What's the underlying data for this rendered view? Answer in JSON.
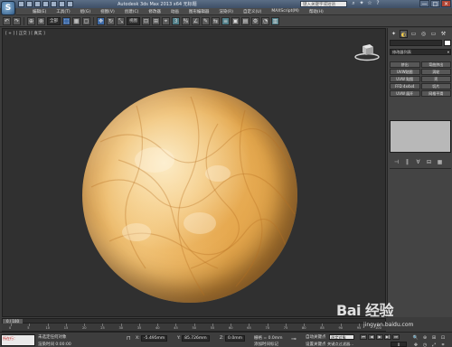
{
  "title_bar": {
    "logo_letter": "S",
    "title": "Autodesk 3ds Max 2013 x64    无标题",
    "search_placeholder": "键入关键字或短语",
    "minimize": "—",
    "maximize": "□",
    "close": "×"
  },
  "menu": [
    "编辑(E)",
    "工具(T)",
    "组(G)",
    "视图(V)",
    "创建(C)",
    "修改器",
    "动画",
    "图形编辑器",
    "渲染(R)",
    "自定义(U)",
    "MAXScript(M)",
    "帮助(H)"
  ],
  "toolbar": {
    "selection_filter": "全部",
    "reference_coord": "视图",
    "buttons": [
      "↶",
      "↷",
      "⊕",
      "⊗",
      "⬚",
      "▦",
      "▢",
      "✥",
      "↻",
      "⤡",
      "⊡",
      "⊞",
      "⌖",
      "3",
      "%",
      "∠",
      "✎",
      "⇆",
      "≡",
      "▣",
      "▤",
      "⚙",
      "◔",
      "▥"
    ]
  },
  "viewport": {
    "label": "[ + ] [ 正交 ] [ 真实 ]"
  },
  "command_panel": {
    "tabs": [
      "✦",
      "◐",
      "▭",
      "◎",
      "▭",
      "⚒"
    ],
    "modifier_list": "修改器列表",
    "modifier_buttons": [
      "挤出",
      "弯曲挤出",
      "UVW贴图",
      "涡轮",
      "UVW 贴图",
      "壳",
      "FFD 4x4x4",
      "切片",
      "UVW 展开",
      "网格平滑"
    ],
    "stack_buttons": [
      "⊣",
      "‖",
      "∀",
      "⊟",
      "▦"
    ]
  },
  "timeline": {
    "frame_display": "0 / 100",
    "ticks": [
      "0",
      "5",
      "10",
      "15",
      "20",
      "25",
      "30",
      "35",
      "40",
      "45",
      "50",
      "55",
      "60",
      "65",
      "70",
      "75",
      "80",
      "85",
      "90",
      "95",
      "100"
    ]
  },
  "status": {
    "maxscript_label": "所在行：",
    "selection": "未选定任何对象",
    "prompt": "渲染时间  0:00:00",
    "x_label": "X:",
    "x_value": "-5.495mm",
    "y_label": "Y:",
    "y_value": "85.726mm",
    "z_label": "Z:",
    "z_value": "0.0mm",
    "grid": "栅格 = 0.0mm",
    "add_time_tag": "添加时间标记",
    "auto_key": "自动关键点",
    "set_key": "设置关键点",
    "selected_dropdown": "选定对象",
    "key_filters": "关键点过滤器...",
    "playback": [
      "⏮",
      "◀",
      "▶",
      "▶|",
      "⏭"
    ],
    "frame": "0",
    "nav": [
      "🔍",
      "⊕",
      "⊞",
      "⊡",
      "✥",
      "◷",
      "⤢",
      "⌗"
    ]
  },
  "watermark": {
    "text": "Bai 经验",
    "url": "jingyan.baidu.com"
  }
}
